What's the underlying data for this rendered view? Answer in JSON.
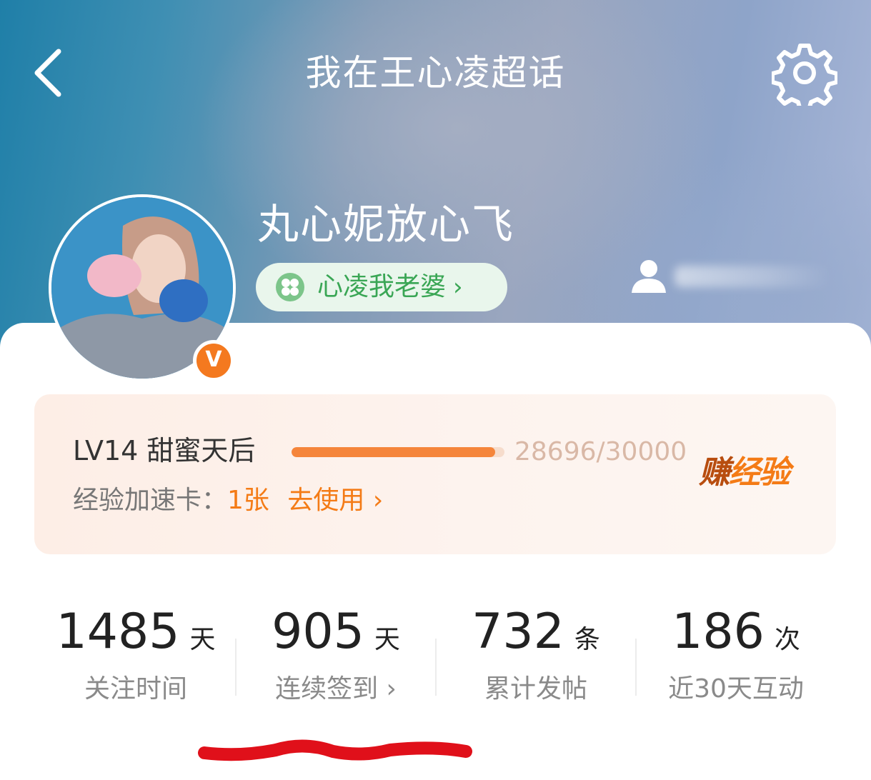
{
  "header": {
    "title": "我在王心凌超话",
    "back_icon": "chevron-left-icon",
    "settings_icon": "gear-icon"
  },
  "profile": {
    "username": "丸心妮放心飞",
    "fan_badge": "心凌我老婆",
    "verified_badge": "V",
    "user_icon": "user-icon"
  },
  "level": {
    "name": "LV14 甜蜜天后",
    "progress_text": "28696/30000",
    "progress_fraction": 0.9565,
    "earn_label": "赚经验",
    "speed_card_label": "经验加速卡：",
    "speed_card_count": "1张",
    "speed_card_action": "去使用"
  },
  "stats": [
    {
      "value": "1485",
      "unit": "天",
      "label": "关注时间"
    },
    {
      "value": "905",
      "unit": "天",
      "label": "连续签到 ›"
    },
    {
      "value": "732",
      "unit": "条",
      "label": "累计发帖"
    },
    {
      "value": "186",
      "unit": "次",
      "label": "近30天互动"
    }
  ],
  "colors": {
    "accent_orange": "#f47b16",
    "fan_green": "#3aa655",
    "annotation_red": "#e0101a"
  }
}
